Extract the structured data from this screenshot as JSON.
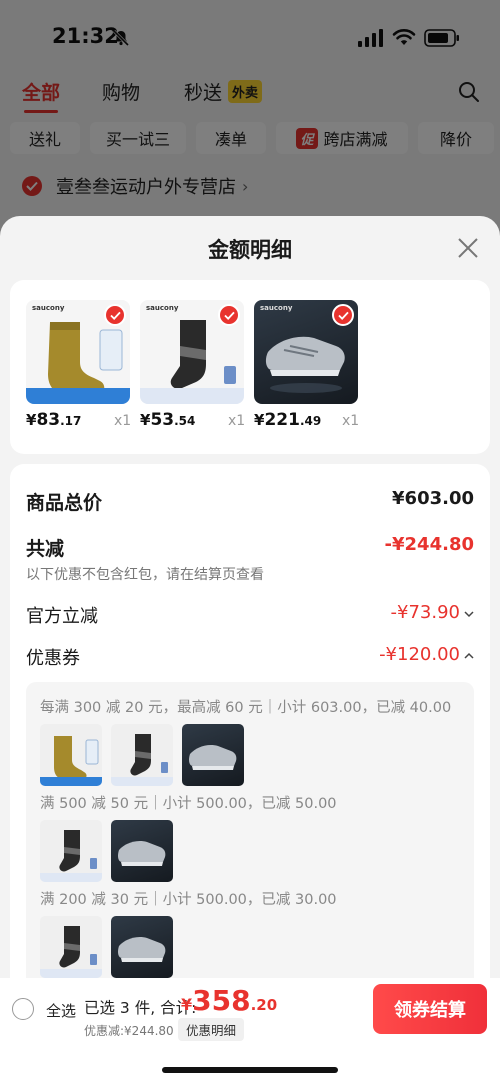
{
  "status_bar": {
    "time": "21:32"
  },
  "background": {
    "tabs": [
      {
        "label": "全部",
        "active": true
      },
      {
        "label": "购物",
        "active": false
      },
      {
        "label": "秒送",
        "active": false
      }
    ],
    "waimai_badge": "外卖",
    "filters": [
      "送礼",
      "买一试三",
      "凑单",
      "跨店满减",
      "降价"
    ],
    "cu_badge": "促",
    "store_name": "壹叁叁运动户外专营店",
    "store_arrow": "›"
  },
  "sheet": {
    "title": "金额明细",
    "products": [
      {
        "yen": "¥",
        "price_int": "83",
        "price_dec": ".17",
        "qty": "x1",
        "image": "sock-yellow",
        "brand": "saucony"
      },
      {
        "yen": "¥",
        "price_int": "53",
        "price_dec": ".54",
        "qty": "x1",
        "image": "sock-black",
        "brand": "saucony"
      },
      {
        "yen": "¥",
        "price_int": "221",
        "price_dec": ".49",
        "qty": "x1",
        "image": "shoe-silver",
        "brand": "saucony"
      }
    ],
    "summary": {
      "total_label": "商品总价",
      "total_value": "¥603.00",
      "reduce_label": "共减",
      "reduce_value": "-¥244.80",
      "reduce_note": "以下优惠不包含红包，请在结算页查看",
      "official_label": "官方立减",
      "official_value": "-¥73.90",
      "coupon_label": "优惠券",
      "coupon_value": "-¥120.00"
    },
    "coupon_rules": [
      {
        "text": "每满 300 减 20 元，最高减 60 元｜小计 603.00，已减 40.00",
        "items": [
          "sock-yellow",
          "sock-black",
          "shoe-silver"
        ]
      },
      {
        "text": "满 500 减 50 元｜小计 500.00，已减 50.00",
        "items": [
          "sock-black",
          "shoe-silver"
        ]
      },
      {
        "text": "满 200 减 30 元｜小计 500.00，已减 30.00",
        "items": [
          "sock-black",
          "shoe-silver"
        ]
      }
    ]
  },
  "bottom_bar": {
    "select_all": "全选",
    "selected_text": "已选 3 件, 合计:",
    "total_yen": "¥",
    "total_int": "358",
    "total_dec": ".20",
    "discount_line": "优惠减:¥244.80",
    "detail_chip": "优惠明细",
    "checkout": "领券结算"
  },
  "colors": {
    "accent": "#e8332e",
    "badge_yellow": "#ffd633"
  }
}
